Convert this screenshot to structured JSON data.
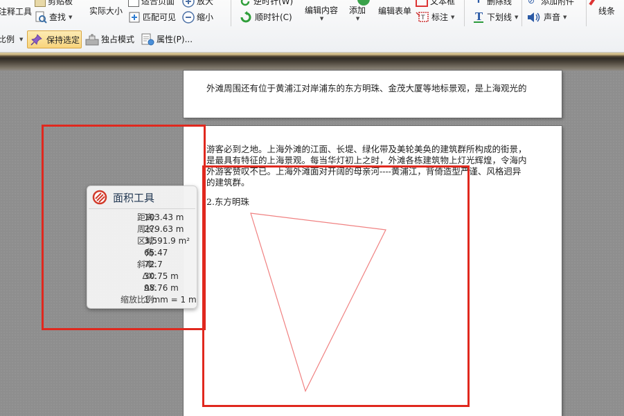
{
  "toolbar": {
    "row1": {
      "annotate_tool": "注释工具",
      "clipboard": "剪贴板",
      "find": "查找",
      "actual_size": "实际大小",
      "fit_page": "适合页面",
      "fit_visible": "匹配可见",
      "zoom_in": "放大",
      "zoom_out": "缩小",
      "rotate_ccw": "逆时针(W)",
      "rotate_cw": "顺时针(C)",
      "edit_content": "编辑内容",
      "add": "添加",
      "edit_form": "编辑表单",
      "textbox": "文本框",
      "annotation": "标注",
      "strikethrough": "删除线",
      "underline": "下划线",
      "add_file": "添加附件",
      "sound": "声音",
      "lines": "线条"
    },
    "row2": {
      "scale": "比例",
      "keep_selected": "保持选定",
      "exclusive_mode": "独占模式",
      "properties": "属性(P)..."
    }
  },
  "document": {
    "page1_text": "外滩周围还有位于黄浦江对岸浦东的东方明珠、金茂大厦等地标景观，是上海观光的",
    "page2_lines": [
      "游客必到之地。上海外滩的江面、长堤、绿化带及美轮美奂的建筑群所构成的街景，",
      "是最具有特征的上海景观。每当华灯初上之时，外滩各栋建筑物上灯光辉煌，令海内",
      "外游客赞叹不已。上海外滩面对开阔的母亲河----黄浦江，背倚造型严谨、风格迥异",
      "的建筑群。"
    ],
    "section_heading": "2.东方明珠"
  },
  "area_tool": {
    "title": "面积工具",
    "rows": [
      {
        "key": "距离:",
        "value": "103.43 m"
      },
      {
        "key": "周长:",
        "value": "279.63 m"
      },
      {
        "key": "区域:",
        "value": "3,591.9 m²"
      },
      {
        "key": "角:",
        "value": "65.47"
      },
      {
        "key": "斜率:",
        "value": "72.7"
      },
      {
        "key": "ΔX:",
        "value": "30.75 m"
      },
      {
        "key": "ΔY:",
        "value": "98.76 m"
      },
      {
        "key": "缩放比例:",
        "value": "1 mm = 1 m"
      }
    ]
  },
  "colors": {
    "highlight": "#e0281e",
    "triangle_stroke": "#f08080",
    "tool_title": "#1f3550"
  }
}
